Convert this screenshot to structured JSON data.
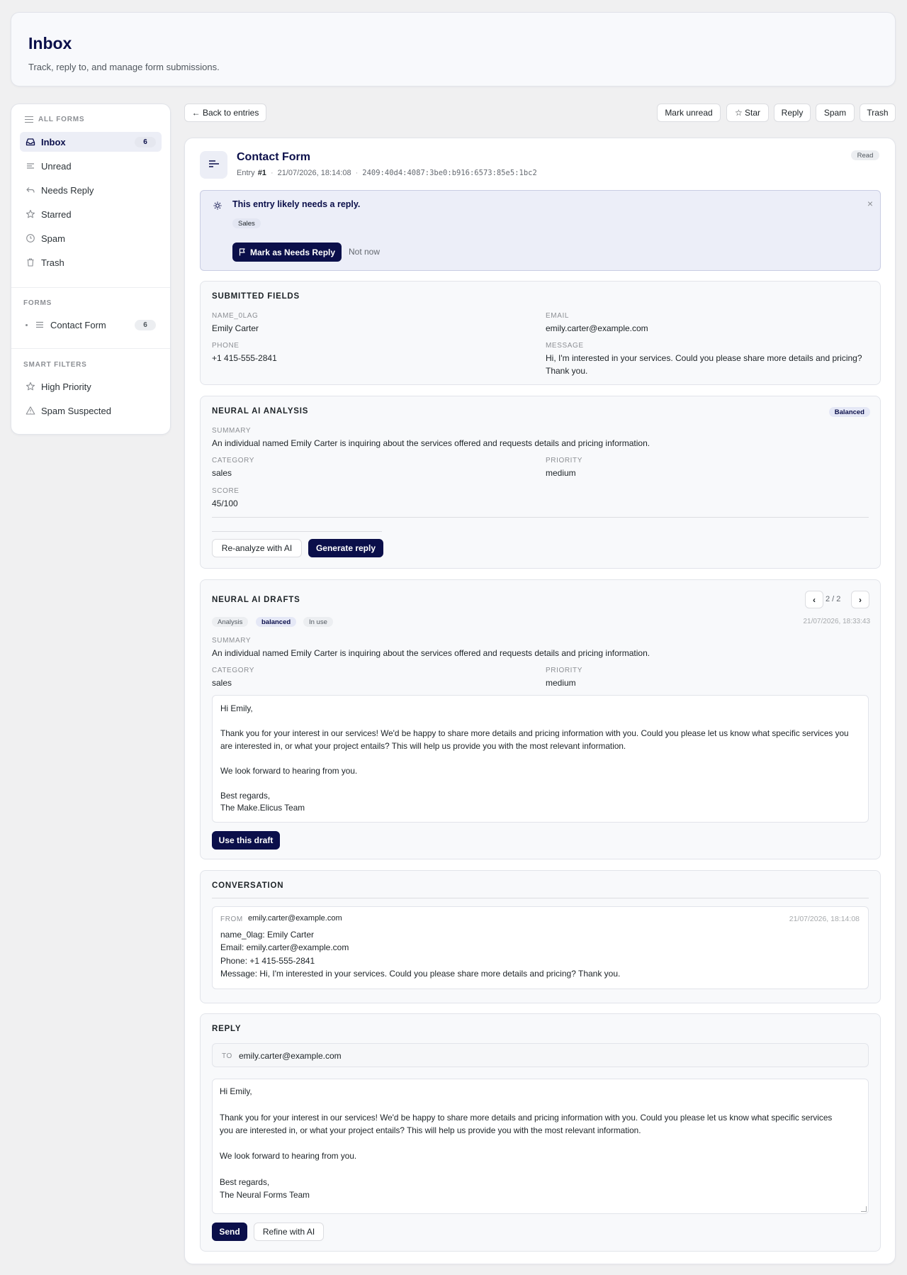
{
  "header": {
    "title": "Inbox",
    "subtitle": "Track, reply to, and manage form submissions."
  },
  "sidebar": {
    "all_forms_label": "ALL FORMS",
    "items": [
      {
        "label": "Inbox",
        "count": "6",
        "icon": "inbox-icon"
      },
      {
        "label": "Unread",
        "icon": "lines-icon"
      },
      {
        "label": "Needs Reply",
        "icon": "reply-icon"
      },
      {
        "label": "Starred",
        "icon": "star-icon"
      },
      {
        "label": "Spam",
        "icon": "clock-icon"
      },
      {
        "label": "Trash",
        "icon": "trash-icon"
      }
    ],
    "forms_label": "FORMS",
    "forms": [
      {
        "label": "Contact Form",
        "count": "6"
      }
    ],
    "smart_filters_label": "SMART FILTERS",
    "smart_filters": [
      {
        "label": "High Priority",
        "icon": "star-icon"
      },
      {
        "label": "Spam Suspected",
        "icon": "warning-icon"
      }
    ]
  },
  "toolbar": {
    "back_label": "← Back to entries",
    "mark_unread": "Mark unread",
    "star": "☆ Star",
    "reply": "Reply",
    "spam": "Spam",
    "trash": "Trash"
  },
  "entry": {
    "form_name": "Contact Form",
    "entry_prefix": "Entry",
    "entry_number": "#1",
    "datetime": "21/07/2026, 18:14:08",
    "ip": "2409:40d4:4087:3be0:b916:6573:85e5:1bc2",
    "status": "Read"
  },
  "suggestion": {
    "title": "This entry likely needs a reply.",
    "tag": "Sales",
    "primary": "Mark as Needs Reply",
    "secondary": "Not now"
  },
  "fields": {
    "title": "SUBMITTED FIELDS",
    "name_label": "NAME_0LAG",
    "name_value": "Emily Carter",
    "email_label": "EMAIL",
    "email_value": "emily.carter@example.com",
    "phone_label": "PHONE",
    "phone_value": "+1 415-555-2841",
    "message_label": "MESSAGE",
    "message_value": "Hi, I'm interested in your services. Could you please share more details and pricing? Thank you."
  },
  "analysis": {
    "title": "NEURAL AI ANALYSIS",
    "badge": "Balanced",
    "summary_label": "SUMMARY",
    "summary": "An individual named Emily Carter is inquiring about the services offered and requests details and pricing information.",
    "category_label": "CATEGORY",
    "category": "sales",
    "priority_label": "PRIORITY",
    "priority": "medium",
    "score_label": "SCORE",
    "score": "45/100",
    "reanalyze": "Re-analyze with AI",
    "generate": "Generate reply"
  },
  "drafts": {
    "title": "NEURAL AI DRAFTS",
    "pager": "2 / 2",
    "prev": "‹",
    "next": "›",
    "chip_analysis": "Analysis",
    "chip_mode": "balanced",
    "chip_inuse": "In use",
    "timestamp": "21/07/2026, 18:33:43",
    "summary_label": "SUMMARY",
    "summary": "An individual named Emily Carter is inquiring about the services offered and requests details and pricing information.",
    "category_label": "CATEGORY",
    "category": "sales",
    "priority_label": "PRIORITY",
    "priority": "medium",
    "body": "Hi Emily,\n\nThank you for your interest in our services! We'd be happy to share more details and pricing information with you. Could you please let us know what specific services you\nare interested in, or what your project entails? This will help us provide you with the most relevant information.\n\nWe look forward to hearing from you.\n\nBest regards,\nThe Make.Elicus Team",
    "use_label": "Use this draft"
  },
  "conversation": {
    "title": "CONVERSATION",
    "from_label": "FROM",
    "from": "emily.carter@example.com",
    "timestamp": "21/07/2026, 18:14:08",
    "body": "name_0lag: Emily Carter\nEmail: emily.carter@example.com\nPhone: +1 415-555-2841\nMessage: Hi, I'm interested in your services. Could you please share more details and pricing? Thank you."
  },
  "reply": {
    "title": "REPLY",
    "to_label": "TO",
    "to": "emily.carter@example.com",
    "body": "Hi Emily,\n\nThank you for your interest in our services! We'd be happy to share more details and pricing information with you. Could you please let us know what specific services\nyou are interested in, or what your project entails? This will help us provide you with the most relevant information.\n\nWe look forward to hearing from you.\n\nBest regards,\nThe Neural Forms Team",
    "send": "Send",
    "refine": "Refine with AI"
  },
  "colors": {
    "accent": "#0b0f4a",
    "background": "#f0f0f1",
    "suggestion_bg": "#eceef8"
  }
}
